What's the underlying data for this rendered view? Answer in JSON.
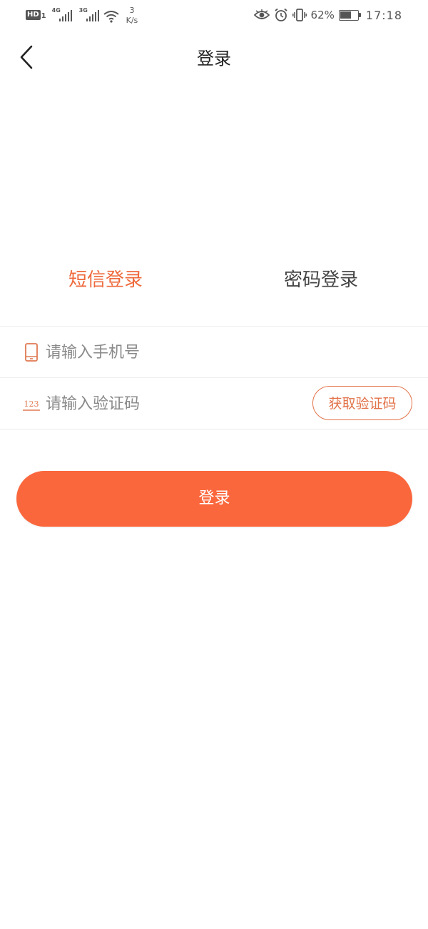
{
  "status_bar": {
    "hd_label": "HD",
    "hd_sim": "1",
    "net1_label": "4G",
    "net2_label": "3G",
    "speed_value": "3",
    "speed_unit": "K/s",
    "battery_percent": "62%",
    "battery_level": 0.62,
    "time": "17:18",
    "icons": [
      "eye-icon",
      "alarm-icon",
      "vibrate-icon"
    ]
  },
  "nav": {
    "title": "登录",
    "back_icon": "chevron-left-icon"
  },
  "tabs": {
    "sms_label": "短信登录",
    "password_label": "密码登录",
    "active": "sms"
  },
  "form": {
    "phone_placeholder": "请输入手机号",
    "phone_value": "",
    "code_placeholder": "请输入验证码",
    "code_value": "",
    "code_icon_text": "123",
    "get_code_label": "获取验证码"
  },
  "login_button": {
    "label": "登录"
  },
  "colors": {
    "accent": "#FB673D",
    "tab_active": "#EE6A3C",
    "outline": "#E2734A",
    "icon_accent": "#E07A52"
  }
}
